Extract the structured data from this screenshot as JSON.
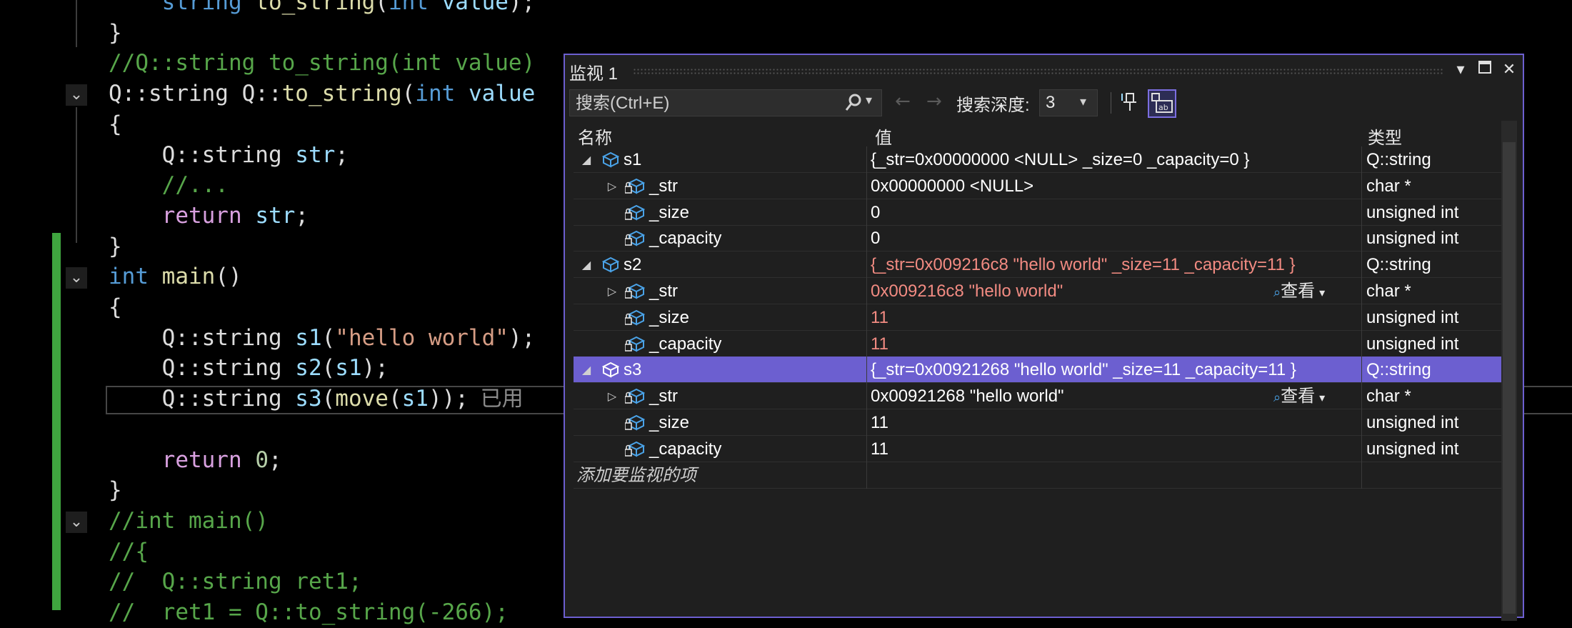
{
  "editor": {
    "lines": [
      {
        "parts": [
          [
            "    ",
            "ns"
          ],
          [
            "string ",
            "kw"
          ],
          [
            "to_string",
            "fn"
          ],
          [
            "(",
            "ns"
          ],
          [
            "int ",
            "kw"
          ],
          [
            "value",
            "var"
          ],
          [
            ");",
            "ns"
          ]
        ]
      },
      {
        "parts": [
          [
            "}",
            "ns"
          ]
        ]
      },
      {
        "parts": [
          [
            "//Q::string to_string(int value)",
            "cm"
          ]
        ]
      },
      {
        "parts": [
          [
            "Q::string Q::",
            "ns"
          ],
          [
            "to_string",
            "fn"
          ],
          [
            "(",
            "ns"
          ],
          [
            "int ",
            "kw"
          ],
          [
            "value",
            "var"
          ]
        ]
      },
      {
        "parts": [
          [
            "{",
            "ns"
          ]
        ]
      },
      {
        "parts": [
          [
            "    Q::string ",
            "ns"
          ],
          [
            "str",
            "var"
          ],
          [
            ";",
            "ns"
          ]
        ]
      },
      {
        "parts": [
          [
            "    //...",
            "cm"
          ]
        ]
      },
      {
        "parts": [
          [
            "    ",
            "ns"
          ],
          [
            "return ",
            "ctrl"
          ],
          [
            "str",
            "var"
          ],
          [
            ";",
            "ns"
          ]
        ]
      },
      {
        "parts": [
          [
            "}",
            "ns"
          ]
        ]
      },
      {
        "parts": [
          [
            "int ",
            "kw"
          ],
          [
            "main",
            "fn"
          ],
          [
            "()",
            "ns"
          ]
        ]
      },
      {
        "parts": [
          [
            "{",
            "ns"
          ]
        ]
      },
      {
        "parts": [
          [
            "    Q::string ",
            "ns"
          ],
          [
            "s1",
            "var"
          ],
          [
            "(",
            "ns"
          ],
          [
            "\"hello world\"",
            "str"
          ],
          [
            ");",
            "ns"
          ]
        ]
      },
      {
        "parts": [
          [
            "    Q::string ",
            "ns"
          ],
          [
            "s2",
            "var"
          ],
          [
            "(",
            "ns"
          ],
          [
            "s1",
            "var"
          ],
          [
            ");",
            "ns"
          ]
        ]
      },
      {
        "parts": [
          [
            "    Q::string ",
            "ns"
          ],
          [
            "s3",
            "var"
          ],
          [
            "(",
            "ns"
          ],
          [
            "move",
            "fn"
          ],
          [
            "(",
            "ns"
          ],
          [
            "s1",
            "var"
          ],
          [
            "));",
            "ns"
          ],
          [
            "  已用",
            "hint"
          ]
        ]
      },
      {
        "parts": [
          [
            "",
            "ns"
          ]
        ]
      },
      {
        "parts": [
          [
            "    ",
            "ns"
          ],
          [
            "return ",
            "ctrl"
          ],
          [
            "0",
            "num"
          ],
          [
            ";",
            "ns"
          ]
        ]
      },
      {
        "parts": [
          [
            "}",
            "ns"
          ]
        ]
      },
      {
        "parts": [
          [
            "//int main()",
            "cm"
          ]
        ]
      },
      {
        "parts": [
          [
            "//{",
            "cm"
          ]
        ]
      },
      {
        "parts": [
          [
            "//  Q::string ret1;",
            "cm"
          ]
        ]
      },
      {
        "parts": [
          [
            "//  ret1 = Q::to_string(-266);",
            "cm"
          ]
        ]
      }
    ]
  },
  "watch": {
    "title": "监视 1",
    "search_placeholder": "搜索(Ctrl+E)",
    "depth_label": "搜索深度:",
    "depth_value": "3",
    "headers": {
      "name": "名称",
      "value": "值",
      "type": "类型"
    },
    "view_label": "查看",
    "add_item": "添加要监视的项",
    "rows": [
      {
        "level": 0,
        "expanded": true,
        "icon": "object",
        "name": "s1",
        "value": "{_str=0x00000000 <NULL> _size=0 _capacity=0 }",
        "type": "Q::string",
        "changed": false,
        "view": false
      },
      {
        "level": 1,
        "expanded": false,
        "icon": "field-private",
        "name": "_str",
        "value": "0x00000000 <NULL>",
        "type": "char *",
        "changed": false,
        "view": false,
        "hasExpander": true
      },
      {
        "level": 1,
        "icon": "field-private",
        "name": "_size",
        "value": "0",
        "type": "unsigned int",
        "changed": false,
        "view": false
      },
      {
        "level": 1,
        "icon": "field-private",
        "name": "_capacity",
        "value": "0",
        "type": "unsigned int",
        "changed": false,
        "view": false
      },
      {
        "level": 0,
        "expanded": true,
        "icon": "object",
        "name": "s2",
        "value": "{_str=0x009216c8 \"hello world\" _size=11 _capacity=11 }",
        "type": "Q::string",
        "changed": true,
        "view": false
      },
      {
        "level": 1,
        "expanded": false,
        "icon": "field-private",
        "name": "_str",
        "value": "0x009216c8 \"hello world\"",
        "type": "char *",
        "changed": true,
        "view": true,
        "hasExpander": true
      },
      {
        "level": 1,
        "icon": "field-private",
        "name": "_size",
        "value": "11",
        "type": "unsigned int",
        "changed": true,
        "view": false
      },
      {
        "level": 1,
        "icon": "field-private",
        "name": "_capacity",
        "value": "11",
        "type": "unsigned int",
        "changed": true,
        "view": false
      },
      {
        "level": 0,
        "expanded": true,
        "icon": "object",
        "name": "s3",
        "value": "{_str=0x00921268 \"hello world\" _size=11 _capacity=11 }",
        "type": "Q::string",
        "changed": true,
        "view": false,
        "selected": true
      },
      {
        "level": 1,
        "expanded": false,
        "icon": "field-private",
        "name": "_str",
        "value": "0x00921268 \"hello world\"",
        "type": "char *",
        "changed": false,
        "view": true,
        "hasExpander": true
      },
      {
        "level": 1,
        "icon": "field-private",
        "name": "_size",
        "value": "11",
        "type": "unsigned int",
        "changed": false,
        "view": false
      },
      {
        "level": 1,
        "icon": "field-private",
        "name": "_capacity",
        "value": "11",
        "type": "unsigned int",
        "changed": false,
        "view": false
      }
    ]
  },
  "colors": {
    "accent": "#6c5fd0",
    "changed_value": "#f28b82",
    "change_bar": "#3fa53f"
  }
}
